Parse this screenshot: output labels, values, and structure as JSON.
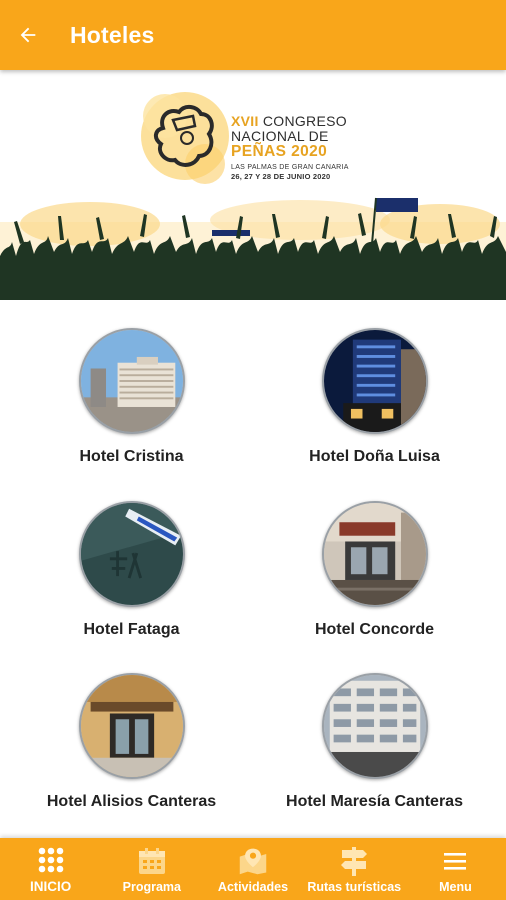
{
  "appbar": {
    "title": "Hoteles",
    "back_icon": "arrow-left-icon"
  },
  "banner": {
    "line1_roman": "XVII",
    "line1_rest": "CONGRESO",
    "line2": "NACIONAL DE",
    "line3": "PEÑAS 2020",
    "line4": "LAS PALMAS DE GRAN CANARIA",
    "line5": "26, 27 Y 28 DE JUNIO 2020"
  },
  "hotels": [
    {
      "name": "Hotel Cristina"
    },
    {
      "name": "Hotel Doña Luisa"
    },
    {
      "name": "Hotel Fataga"
    },
    {
      "name": "Hotel Concorde"
    },
    {
      "name": "Hotel Alisios Canteras"
    },
    {
      "name": "Hotel Maresía Canteras"
    }
  ],
  "bottom_nav": [
    {
      "label": "INICIO",
      "icon": "grid-icon"
    },
    {
      "label": "Programa",
      "icon": "calendar-icon"
    },
    {
      "label": "Actividades",
      "icon": "map-pin-icon"
    },
    {
      "label": "Rutas turísticas",
      "icon": "signpost-icon"
    },
    {
      "label": "Menu",
      "icon": "hamburger-icon"
    }
  ],
  "colors": {
    "accent": "#f9a61a",
    "gold_text": "#e7a321",
    "crowd": "#1f3523"
  }
}
